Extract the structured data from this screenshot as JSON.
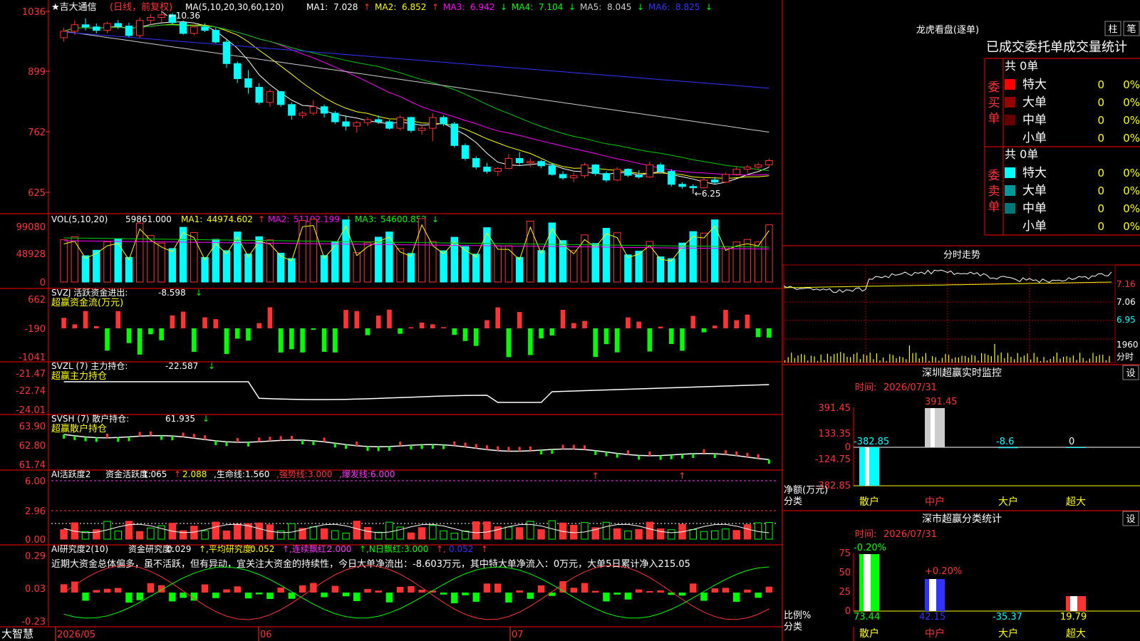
{
  "app": {
    "brand": "大智慧"
  },
  "main_chart": {
    "stock_name": "★吉大通信",
    "period_label": "(日线，前复权)",
    "ma_title": "MA(5,10,20,30,60,120)",
    "ma_items": [
      {
        "label": "MA1:",
        "value": "7.028",
        "arrow": "↑",
        "color": "#ffffff"
      },
      {
        "label": "MA2:",
        "value": "6.852",
        "arrow": "↑",
        "color": "#ffff00"
      },
      {
        "label": "MA3:",
        "value": "6.942",
        "arrow": "↓",
        "color": "#ff00ff"
      },
      {
        "label": "MA4:",
        "value": "7.104",
        "arrow": "↓",
        "color": "#00ff00"
      },
      {
        "label": "MA5:",
        "value": "8.045",
        "arrow": "↓",
        "color": "#cccccc"
      },
      {
        "label": "MA6:",
        "value": "8.825",
        "arrow": "↓",
        "color": "#3333ff"
      }
    ],
    "y_ticks": [
      "1036",
      "899",
      "762",
      "625"
    ],
    "high_label": "10.36",
    "low_label": "6.25"
  },
  "vol_panel": {
    "title": "VOL(5,10,20)",
    "value": "59861.000",
    "ma_items": [
      {
        "label": "MA1:",
        "value": "44974.602",
        "arrow": "↑",
        "color": "#ffff00"
      },
      {
        "label": "MA2:",
        "value": "51192.199",
        "arrow": "↓",
        "color": "#ff00ff"
      },
      {
        "label": "MA3:",
        "value": "54600.852",
        "arrow": "↓",
        "color": "#00ff00"
      }
    ],
    "y_ticks": [
      "99080",
      "48928",
      "0"
    ]
  },
  "svzj_panel": {
    "title": "SVZJ  活跃资金进出:",
    "value": "-8.598",
    "arrow": "↓",
    "subtitle": "超赢资金流(万元)",
    "y_ticks": [
      "662",
      "-190",
      "-1041"
    ]
  },
  "svzl_panel": {
    "title": "SVZL (7) 主力持仓:",
    "value": "-22.587",
    "arrow": "↓",
    "subtitle": "超赢主力持仓",
    "y_ticks": [
      "-21.47",
      "-22.74",
      "-24.01"
    ]
  },
  "svsh_panel": {
    "title": "SVSH (7) 散户持仓:",
    "value": "61.935",
    "arrow": "↓",
    "subtitle": "超赢散户持仓",
    "y_ticks": [
      "63.90",
      "62.80",
      "61.74"
    ]
  },
  "ai1_panel": {
    "title": "AI活跃度2",
    "items": [
      {
        "text": "资金活跃度:",
        "color": "#ffffff"
      },
      {
        "text": "1.065",
        "color": "#ffffff"
      },
      {
        "text": "↑",
        "color": "#ff3333"
      },
      {
        "text": "2.088",
        "color": "#ffff00"
      },
      {
        "text": ",生命线:",
        "color": "#ffffff"
      },
      {
        "text": "1.560",
        "color": "#ffffff"
      },
      {
        "text": ",强势线:",
        "color": "#ff3333"
      },
      {
        "text": "3.000",
        "color": "#ff3333"
      },
      {
        "text": ",爆发线:",
        "color": "#ff33ff"
      },
      {
        "text": "6.000",
        "color": "#ff33ff"
      }
    ],
    "y_ticks": [
      "6.00",
      "2.96",
      "0.00"
    ]
  },
  "ai2_panel": {
    "title": "AI研究度2(10)",
    "items": [
      {
        "text": "资金研究度:",
        "color": "#ffffff"
      },
      {
        "text": "0.029",
        "color": "#ffffff"
      },
      {
        "text": "↑,平均研究度:",
        "color": "#ffff00"
      },
      {
        "text": "0.052",
        "color": "#ffff00"
      },
      {
        "text": "↑,连续飘红:",
        "color": "#ff33ff"
      },
      {
        "text": "2.000",
        "color": "#ff33ff"
      },
      {
        "text": "↑,N日飘红:",
        "color": "#00ff00"
      },
      {
        "text": "3.000",
        "color": "#00ff00"
      },
      {
        "text": "↑,",
        "color": "#ff3333"
      },
      {
        "text": "0.052",
        "color": "#3333ff"
      },
      {
        "text": "↑",
        "color": "#ff3333"
      }
    ],
    "comment": "近期大资金总体偏多，虽不活跃，但有异动，宜关注大资金的持续性，今日大单净流出：-8.603万元，其中特大单净流入：0万元，大单5日累计净入215.05",
    "y_ticks": [
      "0.29",
      "0.03",
      "-0.23"
    ]
  },
  "x_axis": {
    "labels": [
      "2026/05",
      "06",
      "07"
    ]
  },
  "right_panel": {
    "dragon_title": "龙虎看盘(逐单)",
    "tab_zhu": "柱",
    "tab_bi": "笔",
    "table_title": "已成交委托单成交量统计",
    "buy_label": "委买单",
    "sell_label": "委卖单",
    "buy": {
      "total": "共 0单",
      "rows": [
        {
          "name": "特大",
          "vol": "0",
          "pct": "0%",
          "color": "#ff0000"
        },
        {
          "name": "大单",
          "vol": "0",
          "pct": "0%",
          "color": "#990000"
        },
        {
          "name": "中单",
          "vol": "0",
          "pct": "0%",
          "color": "#660000"
        },
        {
          "name": "小单",
          "vol": "0",
          "pct": "0%",
          "color": ""
        }
      ]
    },
    "sell": {
      "total": "共 0单",
      "rows": [
        {
          "name": "特大",
          "vol": "0",
          "pct": "0%",
          "color": "#00ffff"
        },
        {
          "name": "大单",
          "vol": "0",
          "pct": "0%",
          "color": "#009999"
        },
        {
          "name": "中单",
          "vol": "0",
          "pct": "0%",
          "color": "#007777"
        },
        {
          "name": "小单",
          "vol": "0",
          "pct": "0%",
          "color": ""
        }
      ]
    },
    "intraday": {
      "title": "分时走势",
      "y_ticks": [
        "7.16",
        "7.06",
        "6.95"
      ],
      "vol_tick": "1960",
      "vol_unit": "分时"
    },
    "monitor": {
      "title": "深圳超赢实时监控",
      "settings": "设",
      "time_label": "时间:",
      "date": "2026/07/31",
      "y_ticks": [
        "391.45",
        "133.35",
        "0",
        "-124.75",
        "-382.85"
      ],
      "y_unit": "净额(万元)",
      "x_title": "分类",
      "categories": [
        "散户",
        "中户",
        "大户",
        "超大"
      ],
      "values": [
        -382.85,
        391.45,
        -8.6,
        0
      ],
      "value_labels": [
        "-382.85",
        "391.45",
        "-8.6",
        "0"
      ]
    },
    "classify": {
      "title": "深市超赢分类统计",
      "settings": "设",
      "time_label": "时间:",
      "date": "2026/07/31",
      "y_ticks": [
        "75",
        "50",
        "25",
        "0"
      ],
      "y_unit": "比例%",
      "x_title": "分类",
      "categories": [
        "散户",
        "中户",
        "大户",
        "超大"
      ],
      "values": [
        73.44,
        42.15,
        -35.37,
        19.79
      ],
      "value_labels": [
        "73.44",
        "42.15",
        "-35.37",
        "19.79"
      ],
      "top_labels": [
        "-0.20%",
        "+0.20%"
      ]
    }
  },
  "chart_data": [
    {
      "type": "candlestick",
      "title": "★吉大通信 (日线，前复权)",
      "x_labels": [
        "2026/05",
        "06",
        "07"
      ],
      "y_ticks": [
        1036,
        899,
        762,
        625
      ],
      "annotations": [
        "10.36",
        "6.25"
      ],
      "series": [
        {
          "name": "MA1",
          "close": 7.028
        },
        {
          "name": "MA2",
          "close": 6.852
        },
        {
          "name": "MA3",
          "close": 6.942
        },
        {
          "name": "MA4",
          "close": 7.104
        },
        {
          "name": "MA5",
          "close": 8.045
        },
        {
          "name": "MA6",
          "close": 8.825
        }
      ],
      "ohlc": [
        [
          9.75,
          9.98,
          9.66,
          9.9
        ],
        [
          9.9,
          10.15,
          9.82,
          10.05
        ],
        [
          10.05,
          10.2,
          9.92,
          10.0
        ],
        [
          10.0,
          10.08,
          9.85,
          9.92
        ],
        [
          9.92,
          10.12,
          9.86,
          10.08
        ],
        [
          10.08,
          10.16,
          9.95,
          10.02
        ],
        [
          10.02,
          10.1,
          9.76,
          9.8
        ],
        [
          9.8,
          10.22,
          9.75,
          10.15
        ],
        [
          10.15,
          10.3,
          10.05,
          10.22
        ],
        [
          10.22,
          10.36,
          10.1,
          10.28
        ],
        [
          10.28,
          10.32,
          10.05,
          10.1
        ],
        [
          10.1,
          10.15,
          9.82,
          9.85
        ],
        [
          9.85,
          10.05,
          9.8,
          10.0
        ],
        [
          10.0,
          10.08,
          9.88,
          9.92
        ],
        [
          9.92,
          9.98,
          9.62,
          9.65
        ],
        [
          9.65,
          9.7,
          9.05,
          9.15
        ],
        [
          9.15,
          9.2,
          8.7,
          8.8
        ],
        [
          8.8,
          9.0,
          8.45,
          8.6
        ],
        [
          8.6,
          8.7,
          8.2,
          8.25
        ],
        [
          8.25,
          8.55,
          8.15,
          8.5
        ],
        [
          8.5,
          8.52,
          8.15,
          8.2
        ],
        [
          8.2,
          8.25,
          7.85,
          7.95
        ],
        [
          7.95,
          8.05,
          7.88,
          8.0
        ],
        [
          8.0,
          8.3,
          7.95,
          8.15
        ],
        [
          8.15,
          8.2,
          7.9,
          8.0
        ],
        [
          8.0,
          8.05,
          7.75,
          7.8
        ],
        [
          7.8,
          7.95,
          7.6,
          7.7
        ],
        [
          7.7,
          7.82,
          7.55,
          7.78
        ],
        [
          7.78,
          7.9,
          7.7,
          7.85
        ],
        [
          7.85,
          7.95,
          7.75,
          7.8
        ],
        [
          7.8,
          7.85,
          7.62,
          7.65
        ],
        [
          7.65,
          7.95,
          7.6,
          7.9
        ],
        [
          7.9,
          7.92,
          7.55,
          7.6
        ],
        [
          7.6,
          7.7,
          7.5,
          7.65
        ],
        [
          7.65,
          8.0,
          7.35,
          7.9
        ],
        [
          7.9,
          7.95,
          7.7,
          7.75
        ],
        [
          7.75,
          7.8,
          7.2,
          7.25
        ],
        [
          7.25,
          7.3,
          6.9,
          6.95
        ],
        [
          6.95,
          7.0,
          6.7,
          6.75
        ],
        [
          6.75,
          6.85,
          6.6,
          6.65
        ],
        [
          6.65,
          6.75,
          6.55,
          6.72
        ],
        [
          6.72,
          7.05,
          6.7,
          6.95
        ],
        [
          6.95,
          7.1,
          6.8,
          6.85
        ],
        [
          6.85,
          6.95,
          6.75,
          6.88
        ],
        [
          6.88,
          6.92,
          6.72,
          6.78
        ],
        [
          6.78,
          6.85,
          6.55,
          6.58
        ],
        [
          6.58,
          6.65,
          6.45,
          6.5
        ],
        [
          6.5,
          6.62,
          6.4,
          6.55
        ],
        [
          6.55,
          6.85,
          6.5,
          6.8
        ],
        [
          6.8,
          6.82,
          6.55,
          6.6
        ],
        [
          6.6,
          6.65,
          6.4,
          6.45
        ],
        [
          6.45,
          6.75,
          6.42,
          6.7
        ],
        [
          6.7,
          6.72,
          6.52,
          6.56
        ],
        [
          6.56,
          6.68,
          6.48,
          6.52
        ],
        [
          6.52,
          6.88,
          6.5,
          6.8
        ],
        [
          6.8,
          6.85,
          6.6,
          6.65
        ],
        [
          6.65,
          6.7,
          6.3,
          6.35
        ],
        [
          6.35,
          6.4,
          6.25,
          6.3
        ],
        [
          6.3,
          6.35,
          6.2,
          6.27
        ],
        [
          6.27,
          6.5,
          6.25,
          6.45
        ],
        [
          6.45,
          6.52,
          6.35,
          6.4
        ],
        [
          6.4,
          6.62,
          6.38,
          6.58
        ],
        [
          6.58,
          6.75,
          6.55,
          6.7
        ],
        [
          6.7,
          6.8,
          6.62,
          6.75
        ],
        [
          6.75,
          6.85,
          6.68,
          6.8
        ],
        [
          6.8,
          6.95,
          6.75,
          6.9
        ]
      ]
    },
    {
      "type": "bar",
      "title": "VOL(5,10,20)",
      "y_ticks": [
        99080,
        48928,
        0
      ],
      "series": [
        {
          "name": "VOL",
          "last": 59861.0
        },
        {
          "name": "MA1",
          "last": 44974.602
        },
        {
          "name": "MA2",
          "last": 51192.199
        },
        {
          "name": "MA3",
          "last": 54600.852
        }
      ]
    },
    {
      "type": "bar",
      "title": "SVZJ 活跃资金进出",
      "y_ticks": [
        662,
        -190,
        -1041
      ],
      "series": [
        {
          "name": "活跃资金进出",
          "last": -8.598
        }
      ]
    },
    {
      "type": "line",
      "title": "SVZL 主力持仓",
      "y_ticks": [
        -21.47,
        -22.74,
        -24.01
      ],
      "series": [
        {
          "name": "主力持仓",
          "last": -22.587
        }
      ]
    },
    {
      "type": "line",
      "title": "SVSH 散户持仓",
      "y_ticks": [
        63.9,
        62.8,
        61.74
      ],
      "series": [
        {
          "name": "散户持仓",
          "last": 61.935
        }
      ]
    },
    {
      "type": "bar",
      "title": "AI活跃度2",
      "y_ticks": [
        6.0,
        2.96,
        0.0
      ],
      "series": [
        {
          "name": "资金活跃度",
          "last": 1.065
        },
        {
          "name": "生命线",
          "last": 1.56
        },
        {
          "name": "强势线",
          "last": 3.0
        },
        {
          "name": "爆发线",
          "last": 6.0
        }
      ]
    },
    {
      "type": "bar",
      "title": "AI研究度2(10)",
      "y_ticks": [
        0.29,
        0.03,
        -0.23
      ],
      "series": [
        {
          "name": "资金研究度",
          "last": 0.029
        },
        {
          "name": "平均研究度",
          "last": 0.052
        }
      ]
    },
    {
      "type": "bar",
      "title": "深圳超赢实时监控",
      "ylabel": "净额(万元)",
      "categories": [
        "散户",
        "中户",
        "大户",
        "超大"
      ],
      "values": [
        -382.85,
        391.45,
        -8.6,
        0
      ],
      "ylim": [
        -382.85,
        391.45
      ]
    },
    {
      "type": "bar",
      "title": "深市超赢分类统计",
      "ylabel": "比例%",
      "categories": [
        "散户",
        "中户",
        "大户",
        "超大"
      ],
      "values": [
        73.44,
        42.15,
        -35.37,
        19.79
      ],
      "ylim": [
        0,
        75
      ]
    }
  ]
}
